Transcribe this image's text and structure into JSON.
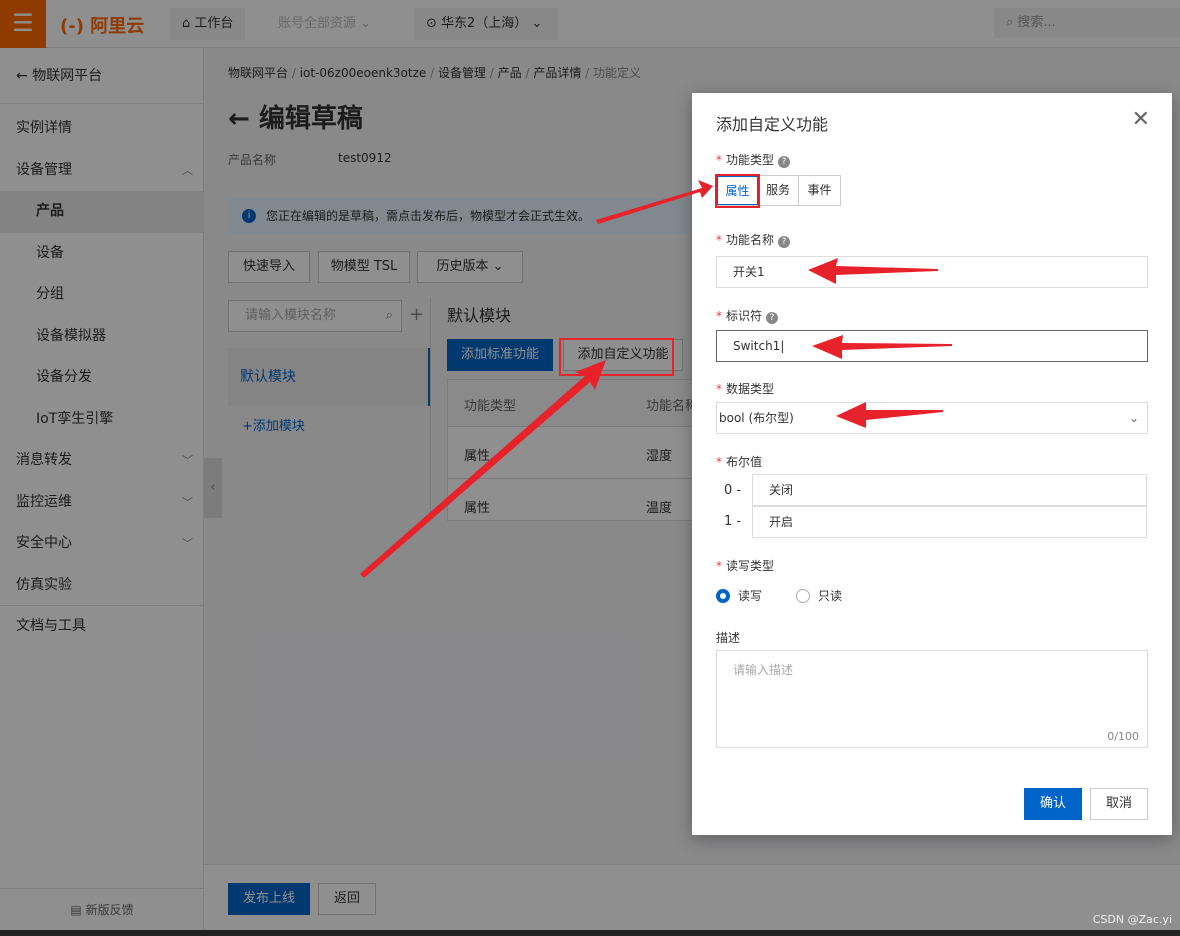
{
  "topbar": {
    "logo": "(-) 阿里云",
    "workbench": "工作台",
    "resources": "账号全部资源",
    "region": "华东2（上海）",
    "search_placeholder": "搜索..."
  },
  "sidebar": {
    "back": "物联网平台",
    "items": [
      {
        "label": "实例详情",
        "sub": false
      },
      {
        "label": "设备管理",
        "sub": false,
        "chev": "up"
      },
      {
        "label": "产品",
        "sub": true,
        "active": true
      },
      {
        "label": "设备",
        "sub": true
      },
      {
        "label": "分组",
        "sub": true
      },
      {
        "label": "设备模拟器",
        "sub": true
      },
      {
        "label": "设备分发",
        "sub": true
      },
      {
        "label": "IoT孪生引擎",
        "sub": true
      },
      {
        "label": "消息转发",
        "sub": false,
        "chev": "down"
      },
      {
        "label": "监控运维",
        "sub": false,
        "chev": "down"
      },
      {
        "label": "安全中心",
        "sub": false,
        "chev": "down"
      },
      {
        "label": "仿真实验",
        "sub": false
      },
      {
        "label": "文档与工具",
        "sub": false
      }
    ],
    "feedback": "新版反馈"
  },
  "main": {
    "breadcrumb": [
      "物联网平台",
      "iot-06z00eoenk3otze",
      "设备管理",
      "产品",
      "产品详情",
      "功能定义"
    ],
    "title": "编辑草稿",
    "product_name_label": "产品名称",
    "product_name": "test0912",
    "notice": "您正在编辑的是草稿，需点击发布后，物模型才会正式生效。",
    "buttons": {
      "quick_import": "快速导入",
      "tsl": "物模型 TSL",
      "history": "历史版本",
      "add_standard": "添加标准功能",
      "add_custom": "添加自定义功能",
      "publish": "发布上线",
      "back": "返回"
    },
    "module_search_placeholder": "请输入模块名称",
    "module": "默认模块",
    "add_module": "+添加模块",
    "module_title": "默认模块",
    "table": {
      "headers": [
        "功能类型",
        "功能名称"
      ],
      "rows": [
        [
          "属性",
          "湿度"
        ],
        [
          "属性",
          "温度"
        ]
      ]
    }
  },
  "dialog": {
    "title": "添加自定义功能",
    "type_label": "功能类型",
    "types": [
      "属性",
      "服务",
      "事件"
    ],
    "selected_type": "属性",
    "name_label": "功能名称",
    "name_value": "开关1",
    "id_label": "标识符",
    "id_value": "Switch1",
    "datatype_label": "数据类型",
    "datatype_value": "bool (布尔型)",
    "bool_label": "布尔值",
    "bool_values": [
      {
        "key": "0 -",
        "value": "关闭"
      },
      {
        "key": "1 -",
        "value": "开启"
      }
    ],
    "rw_label": "读写类型",
    "rw_options": [
      "读写",
      "只读"
    ],
    "rw_selected": "读写",
    "desc_label": "描述",
    "desc_placeholder": "请输入描述",
    "desc_count": "0/100",
    "confirm": "确认",
    "cancel": "取消"
  },
  "watermark": "CSDN @Zac.yi",
  "colors": {
    "brand": "#ff6a00",
    "primary": "#0064c8",
    "annotation": "#e8222a"
  }
}
